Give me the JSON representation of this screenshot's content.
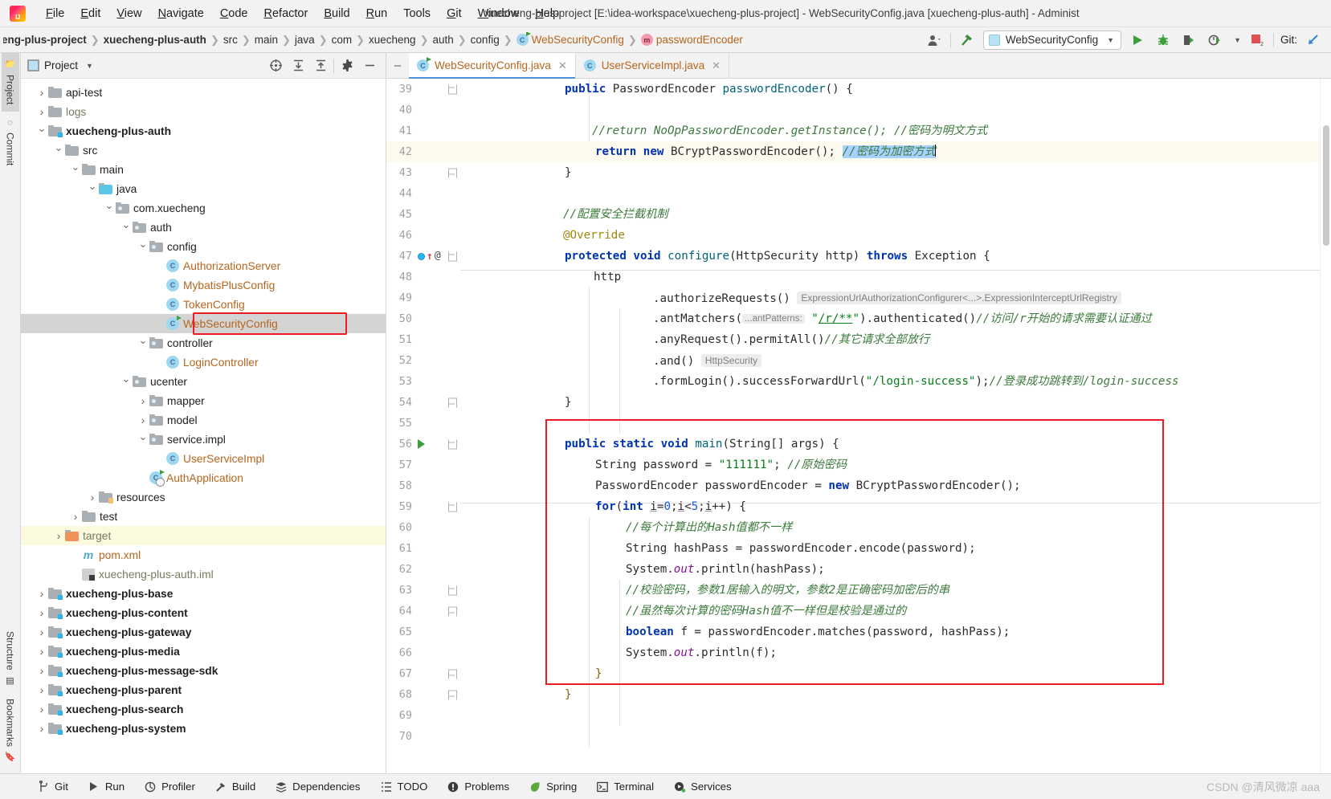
{
  "window": {
    "title": "xuecheng-plus-project [E:\\idea-workspace\\xuecheng-plus-project] - WebSecurityConfig.java [xuecheng-plus-auth] - Administ"
  },
  "menu": [
    {
      "label": "File"
    },
    {
      "label": "Edit"
    },
    {
      "label": "View"
    },
    {
      "label": "Navigate"
    },
    {
      "label": "Code"
    },
    {
      "label": "Refactor"
    },
    {
      "label": "Build"
    },
    {
      "label": "Run"
    },
    {
      "label": "Tools"
    },
    {
      "label": "Git"
    },
    {
      "label": "Window"
    },
    {
      "label": "Help"
    }
  ],
  "breadcrumbs": [
    {
      "label": "eng-plus-project",
      "style": "bold"
    },
    {
      "label": "xuecheng-plus-auth",
      "style": "bold"
    },
    {
      "label": "src",
      "style": "plain"
    },
    {
      "label": "main",
      "style": "plain"
    },
    {
      "label": "java",
      "style": "plain"
    },
    {
      "label": "com",
      "style": "plain"
    },
    {
      "label": "xuecheng",
      "style": "plain"
    },
    {
      "label": "auth",
      "style": "plain"
    },
    {
      "label": "config",
      "style": "plain"
    },
    {
      "label": "WebSecurityConfig",
      "style": "class"
    },
    {
      "label": "passwordEncoder",
      "style": "method"
    }
  ],
  "toolbar": {
    "run_config_label": "WebSecurityConfig",
    "git_label": "Git:",
    "error_count": "2"
  },
  "left_tabs": [
    {
      "label": "Project",
      "active": true
    },
    {
      "label": "Commit",
      "active": false
    },
    {
      "label": "Bookmarks",
      "active": false
    },
    {
      "label": "Structure",
      "active": false
    }
  ],
  "project_panel": {
    "title": "Project",
    "tree": [
      {
        "label": "api-test",
        "depth": 1,
        "arrow": "closed",
        "icon": "folder",
        "style": "plain"
      },
      {
        "label": "logs",
        "depth": 1,
        "arrow": "closed",
        "icon": "folder",
        "style": "muted"
      },
      {
        "label": "xuecheng-plus-auth",
        "depth": 1,
        "arrow": "open",
        "icon": "folder-mod",
        "style": "bold"
      },
      {
        "label": "src",
        "depth": 2,
        "arrow": "open",
        "icon": "folder",
        "style": "plain"
      },
      {
        "label": "main",
        "depth": 3,
        "arrow": "open",
        "icon": "folder",
        "style": "plain"
      },
      {
        "label": "java",
        "depth": 4,
        "arrow": "open",
        "icon": "folder-blue",
        "style": "plain"
      },
      {
        "label": "com.xuecheng",
        "depth": 5,
        "arrow": "open",
        "icon": "package",
        "style": "plain"
      },
      {
        "label": "auth",
        "depth": 6,
        "arrow": "open",
        "icon": "package",
        "style": "plain"
      },
      {
        "label": "config",
        "depth": 7,
        "arrow": "open",
        "icon": "package",
        "style": "plain"
      },
      {
        "label": "AuthorizationServer",
        "depth": 8,
        "arrow": "none",
        "icon": "class",
        "style": "class"
      },
      {
        "label": "MybatisPlusConfig",
        "depth": 8,
        "arrow": "none",
        "icon": "class",
        "style": "class"
      },
      {
        "label": "TokenConfig",
        "depth": 8,
        "arrow": "none",
        "icon": "class",
        "style": "class"
      },
      {
        "label": "WebSecurityConfig",
        "depth": 8,
        "arrow": "none",
        "icon": "class-run",
        "style": "class",
        "selected": true,
        "boxed": true
      },
      {
        "label": "controller",
        "depth": 7,
        "arrow": "open",
        "icon": "package",
        "style": "plain"
      },
      {
        "label": "LoginController",
        "depth": 8,
        "arrow": "none",
        "icon": "class",
        "style": "class"
      },
      {
        "label": "ucenter",
        "depth": 6,
        "arrow": "open",
        "icon": "package",
        "style": "plain"
      },
      {
        "label": "mapper",
        "depth": 7,
        "arrow": "closed",
        "icon": "package",
        "style": "plain"
      },
      {
        "label": "model",
        "depth": 7,
        "arrow": "closed",
        "icon": "package",
        "style": "plain"
      },
      {
        "label": "service.impl",
        "depth": 7,
        "arrow": "open",
        "icon": "package",
        "style": "plain"
      },
      {
        "label": "UserServiceImpl",
        "depth": 8,
        "arrow": "none",
        "icon": "class",
        "style": "class"
      },
      {
        "label": "AuthApplication",
        "depth": 7,
        "arrow": "none",
        "icon": "class-app",
        "style": "class"
      },
      {
        "label": "resources",
        "depth": 4,
        "arrow": "closed",
        "icon": "folder-res",
        "style": "plain"
      },
      {
        "label": "test",
        "depth": 3,
        "arrow": "closed",
        "icon": "folder",
        "style": "plain"
      },
      {
        "label": "target",
        "depth": 2,
        "arrow": "closed",
        "icon": "folder-orange",
        "style": "muted",
        "row_highlight": true
      },
      {
        "label": "pom.xml",
        "depth": 3,
        "arrow": "none",
        "icon": "maven",
        "style": "xml"
      },
      {
        "label": "xuecheng-plus-auth.iml",
        "depth": 3,
        "arrow": "none",
        "icon": "iml",
        "style": "muted"
      },
      {
        "label": "xuecheng-plus-base",
        "depth": 1,
        "arrow": "closed",
        "icon": "folder-mod",
        "style": "bold"
      },
      {
        "label": "xuecheng-plus-content",
        "depth": 1,
        "arrow": "closed",
        "icon": "folder-mod",
        "style": "bold"
      },
      {
        "label": "xuecheng-plus-gateway",
        "depth": 1,
        "arrow": "closed",
        "icon": "folder-mod",
        "style": "bold"
      },
      {
        "label": "xuecheng-plus-media",
        "depth": 1,
        "arrow": "closed",
        "icon": "folder-mod",
        "style": "bold"
      },
      {
        "label": "xuecheng-plus-message-sdk",
        "depth": 1,
        "arrow": "closed",
        "icon": "folder-mod",
        "style": "bold"
      },
      {
        "label": "xuecheng-plus-parent",
        "depth": 1,
        "arrow": "closed",
        "icon": "folder-mod",
        "style": "bold"
      },
      {
        "label": "xuecheng-plus-search",
        "depth": 1,
        "arrow": "closed",
        "icon": "folder-mod",
        "style": "bold"
      },
      {
        "label": "xuecheng-plus-system",
        "depth": 1,
        "arrow": "closed",
        "icon": "folder-mod",
        "style": "bold"
      }
    ]
  },
  "editor": {
    "tabs": [
      {
        "label": "WebSecurityConfig.java",
        "active": true,
        "closable": true
      },
      {
        "label": "UserServiceImpl.java",
        "active": false,
        "closable": true
      }
    ],
    "first_line": 39,
    "lines": [
      {
        "n": 39,
        "text": "public PasswordEncoder passwordEncoder() {"
      },
      {
        "n": 40,
        "text": ""
      },
      {
        "n": 41,
        "text": "//return NoOpPasswordEncoder.getInstance(); //密码为明文方式"
      },
      {
        "n": 42,
        "text": "return new BCryptPasswordEncoder(); //密码为加密方式",
        "highlight": true
      },
      {
        "n": 43,
        "text": "}"
      },
      {
        "n": 44,
        "text": ""
      },
      {
        "n": 45,
        "text": "//配置安全拦截机制"
      },
      {
        "n": 46,
        "text": "@Override"
      },
      {
        "n": 47,
        "text": "protected void configure(HttpSecurity http) throws Exception {"
      },
      {
        "n": 48,
        "text": "http"
      },
      {
        "n": 49,
        "text": ".authorizeRequests() ExpressionUrlAuthorizationConfigurer<...>.ExpressionInterceptUrlRegistry"
      },
      {
        "n": 50,
        "text": ".antMatchers( ...antPatterns: \"/r/**\").authenticated()//访问/r开始的请求需要认证通过"
      },
      {
        "n": 51,
        "text": ".anyRequest().permitAll()//其它请求全部放行"
      },
      {
        "n": 52,
        "text": ".and() HttpSecurity"
      },
      {
        "n": 53,
        "text": ".formLogin().successForwardUrl(\"/login-success\");//登录成功跳转到/login-success"
      },
      {
        "n": 54,
        "text": "}"
      },
      {
        "n": 55,
        "text": ""
      },
      {
        "n": 56,
        "text": "public static void main(String[] args) {"
      },
      {
        "n": 57,
        "text": "String password = \"111111\"; //原始密码"
      },
      {
        "n": 58,
        "text": "PasswordEncoder passwordEncoder = new BCryptPasswordEncoder();"
      },
      {
        "n": 59,
        "text": "for(int i=0;i<5;i++) {"
      },
      {
        "n": 60,
        "text": "//每个计算出的Hash值都不一样"
      },
      {
        "n": 61,
        "text": "String hashPass = passwordEncoder.encode(password);"
      },
      {
        "n": 62,
        "text": "System.out.println(hashPass);"
      },
      {
        "n": 63,
        "text": "//校验密码，参数1居输入的明文，参数2是正确密码加密后的串"
      },
      {
        "n": 64,
        "text": "//虽然每次计算的密码Hash值不一样但是校验是通过的"
      },
      {
        "n": 65,
        "text": "boolean f = passwordEncoder.matches(password, hashPass);"
      },
      {
        "n": 66,
        "text": "System.out.println(f);"
      },
      {
        "n": 67,
        "text": "}"
      },
      {
        "n": 68,
        "text": "}"
      },
      {
        "n": 69,
        "text": ""
      },
      {
        "n": 70,
        "text": ""
      }
    ],
    "selected_text": "//密码为加密方式"
  },
  "status_bar": [
    {
      "label": "Git",
      "icon": "git-branch-icon"
    },
    {
      "label": "Run",
      "icon": "run-icon"
    },
    {
      "label": "Profiler",
      "icon": "profiler-icon"
    },
    {
      "label": "Build",
      "icon": "build-hammer-icon"
    },
    {
      "label": "Dependencies",
      "icon": "dependencies-icon"
    },
    {
      "label": "TODO",
      "icon": "todo-icon"
    },
    {
      "label": "Problems",
      "icon": "problems-icon"
    },
    {
      "label": "Spring",
      "icon": "spring-leaf-icon"
    },
    {
      "label": "Terminal",
      "icon": "terminal-icon"
    },
    {
      "label": "Services",
      "icon": "services-icon"
    }
  ],
  "watermark": "CSDN @清风微凉 aaa",
  "colors": {
    "accent": "#4a90d9",
    "red_box": "#ee1b24",
    "selection": "#a6d2ff",
    "class_text": "#b5651d",
    "keyword": "#0033b3",
    "string": "#067d17",
    "comment": "#8c8c8c"
  }
}
